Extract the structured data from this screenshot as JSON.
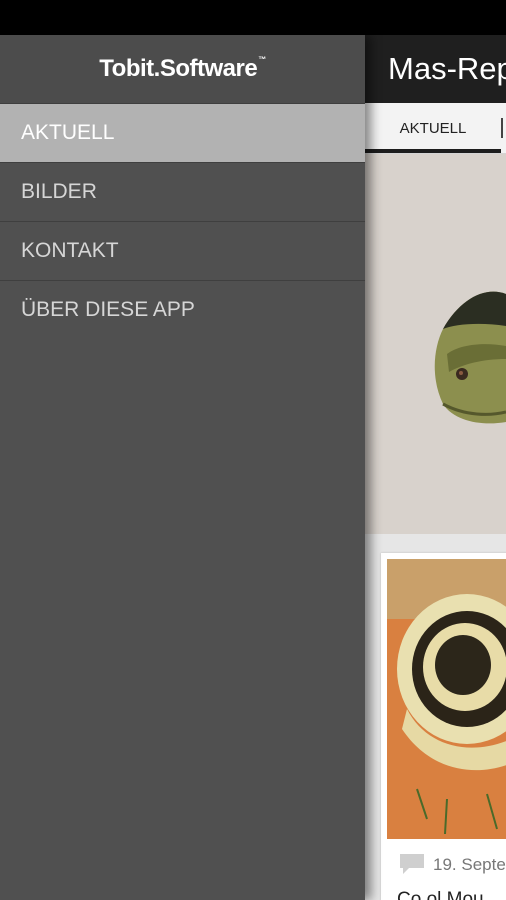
{
  "drawer": {
    "logo": "Tobit.Software",
    "logo_tm": "™",
    "items": [
      {
        "label": "AKTUELL",
        "active": true
      },
      {
        "label": "BILDER",
        "active": false
      },
      {
        "label": "KONTAKT",
        "active": false
      },
      {
        "label": "ÜBER DIESE APP",
        "active": false
      }
    ]
  },
  "app": {
    "title": "Mas-Rep",
    "tabs": [
      {
        "label": "AKTUELL"
      }
    ]
  },
  "card": {
    "date": "19. Septe",
    "title": "Co ol Mou"
  },
  "colors": {
    "drawer_bg": "#505050",
    "active_item_bg": "#b2b2b2",
    "actionbar_bg": "#1f1f1f"
  }
}
